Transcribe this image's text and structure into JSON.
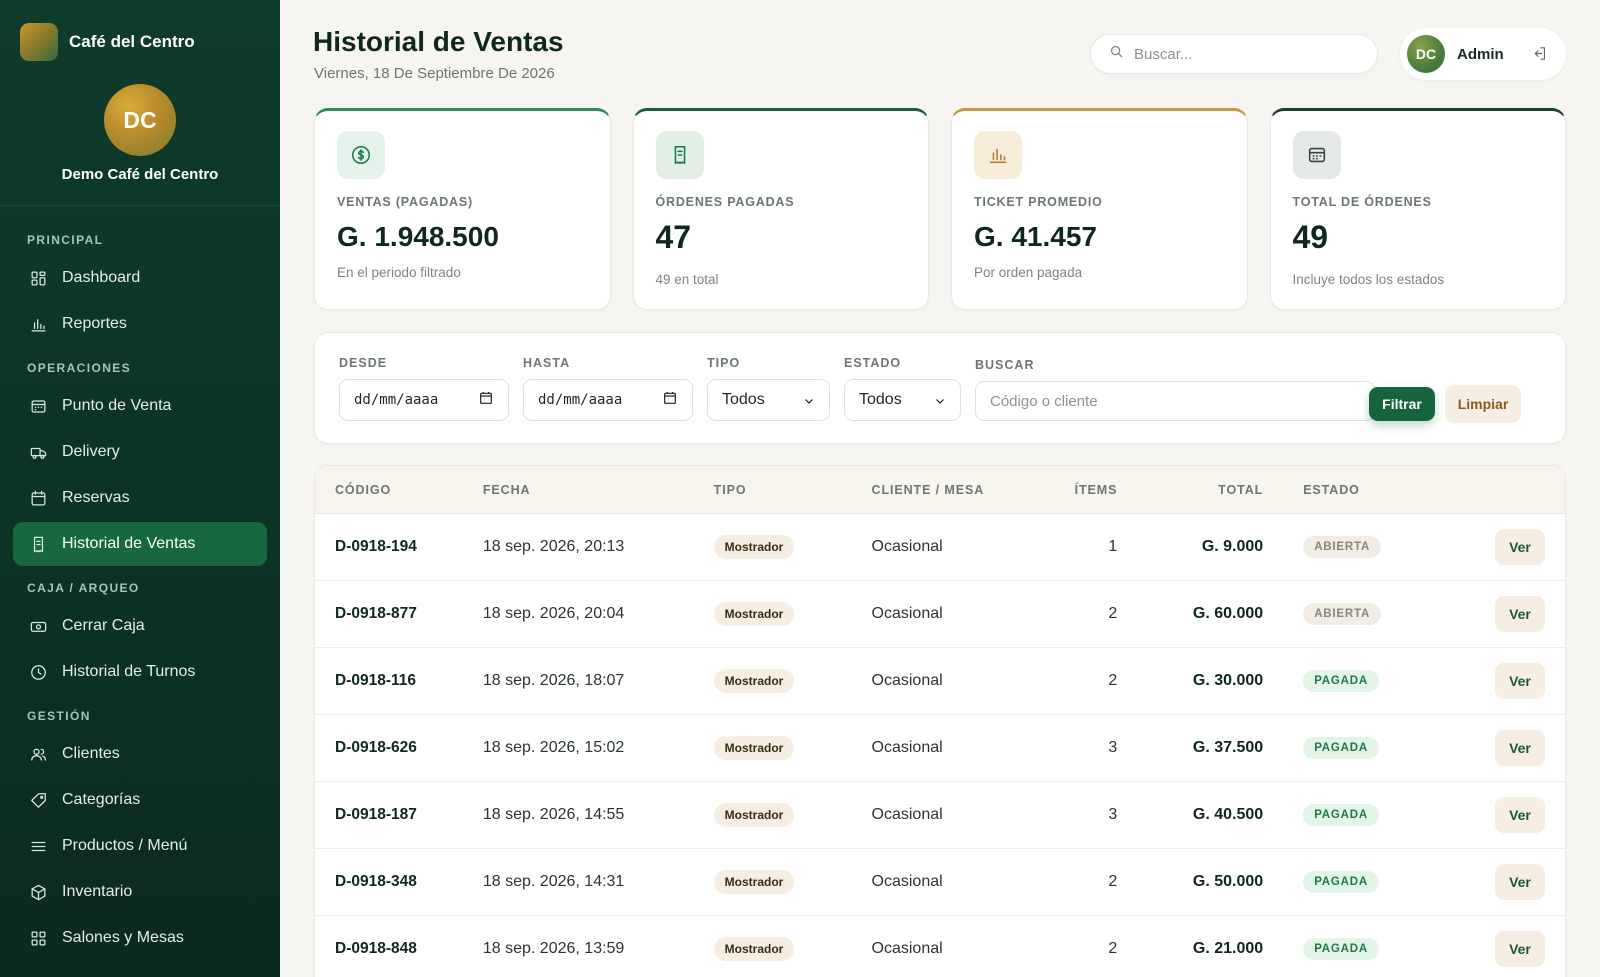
{
  "brand": {
    "name": "Café del Centro"
  },
  "profile": {
    "initials": "DC",
    "name": "Demo Café del Centro"
  },
  "nav": {
    "sections": [
      {
        "title": "PRINCIPAL",
        "items": [
          {
            "label": "Dashboard",
            "icon": "dashboard-icon"
          },
          {
            "label": "Reportes",
            "icon": "bar-chart-icon"
          }
        ]
      },
      {
        "title": "OPERACIONES",
        "items": [
          {
            "label": "Punto de Venta",
            "icon": "register-icon"
          },
          {
            "label": "Delivery",
            "icon": "truck-icon"
          },
          {
            "label": "Reservas",
            "icon": "calendar-icon"
          },
          {
            "label": "Historial de Ventas",
            "icon": "receipt-icon",
            "active": true
          }
        ]
      },
      {
        "title": "CAJA / ARQUEO",
        "items": [
          {
            "label": "Cerrar Caja",
            "icon": "cash-icon"
          },
          {
            "label": "Historial de Turnos",
            "icon": "clock-icon"
          }
        ]
      },
      {
        "title": "GESTIÓN",
        "items": [
          {
            "label": "Clientes",
            "icon": "users-icon"
          },
          {
            "label": "Categorías",
            "icon": "tag-icon"
          },
          {
            "label": "Productos / Menú",
            "icon": "menu-lines-icon"
          },
          {
            "label": "Inventario",
            "icon": "box-icon"
          },
          {
            "label": "Salones y Mesas",
            "icon": "tables-icon"
          }
        ]
      }
    ]
  },
  "header": {
    "title": "Historial de Ventas",
    "date": "Viernes, 18 De Septiembre De 2026",
    "search_placeholder": "Buscar...",
    "user_initials": "DC",
    "user_name": "Admin"
  },
  "stats": [
    {
      "label": "VENTAS (PAGADAS)",
      "value": "G. 1.948.500",
      "sub": "En el periodo filtrado",
      "icon": "money-icon"
    },
    {
      "label": "ÓRDENES PAGADAS",
      "value": "47",
      "sub": "49 en total",
      "icon": "receipt-icon"
    },
    {
      "label": "TICKET PROMEDIO",
      "value": "G. 41.457",
      "sub": "Por orden pagada",
      "icon": "bar-chart-icon"
    },
    {
      "label": "TOTAL DE ÓRDENES",
      "value": "49",
      "sub": "Incluye todos los estados",
      "icon": "register-icon"
    }
  ],
  "filters": {
    "desde_label": "DESDE",
    "desde_value": "dd/mm/aaaa",
    "hasta_label": "HASTA",
    "hasta_value": "dd/mm/aaaa",
    "tipo_label": "TIPO",
    "tipo_value": "Todos",
    "estado_label": "ESTADO",
    "estado_value": "Todos",
    "buscar_label": "BUSCAR",
    "buscar_placeholder": "Código o cliente",
    "filtrar_label": "Filtrar",
    "limpiar_label": "Limpiar"
  },
  "table": {
    "headers": [
      "CÓDIGO",
      "FECHA",
      "TIPO",
      "CLIENTE / MESA",
      "ÍTEMS",
      "TOTAL",
      "ESTADO"
    ],
    "action_label": "Ver",
    "rows": [
      {
        "code": "D-0918-194",
        "date": "18 sep. 2026, 20:13",
        "type": "Mostrador",
        "client": "Ocasional",
        "items": "1",
        "total": "G. 9.000",
        "status": "ABIERTA"
      },
      {
        "code": "D-0918-877",
        "date": "18 sep. 2026, 20:04",
        "type": "Mostrador",
        "client": "Ocasional",
        "items": "2",
        "total": "G. 60.000",
        "status": "ABIERTA"
      },
      {
        "code": "D-0918-116",
        "date": "18 sep. 2026, 18:07",
        "type": "Mostrador",
        "client": "Ocasional",
        "items": "2",
        "total": "G. 30.000",
        "status": "PAGADA"
      },
      {
        "code": "D-0918-626",
        "date": "18 sep. 2026, 15:02",
        "type": "Mostrador",
        "client": "Ocasional",
        "items": "3",
        "total": "G. 37.500",
        "status": "PAGADA"
      },
      {
        "code": "D-0918-187",
        "date": "18 sep. 2026, 14:55",
        "type": "Mostrador",
        "client": "Ocasional",
        "items": "3",
        "total": "G. 40.500",
        "status": "PAGADA"
      },
      {
        "code": "D-0918-348",
        "date": "18 sep. 2026, 14:31",
        "type": "Mostrador",
        "client": "Ocasional",
        "items": "2",
        "total": "G. 50.000",
        "status": "PAGADA"
      },
      {
        "code": "D-0918-848",
        "date": "18 sep. 2026, 13:59",
        "type": "Mostrador",
        "client": "Ocasional",
        "items": "2",
        "total": "G. 21.000",
        "status": "PAGADA"
      }
    ]
  },
  "colors": {
    "sidebar_bg": "#0f3b2c",
    "accent": "#17683f",
    "status_pagada": "#1f7a45",
    "status_abierta": "#8a8577"
  }
}
